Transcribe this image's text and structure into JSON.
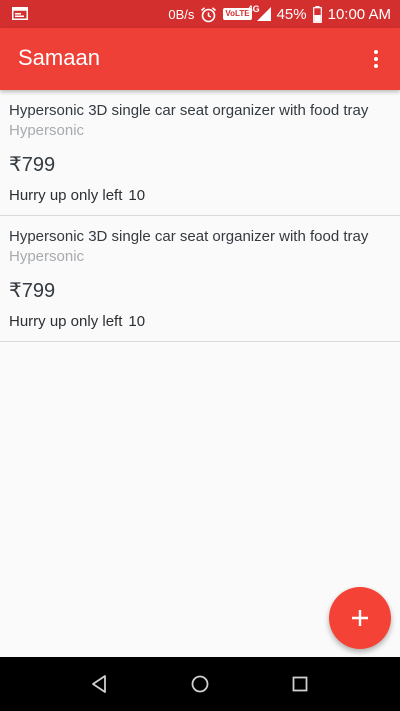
{
  "status_bar": {
    "left_icon": "notification-card-icon",
    "speed": "0B/s",
    "alarm_icon": "alarm-clock-icon",
    "volte": "VoLTE",
    "network": "4G",
    "signal_icon": "signal-icon",
    "battery_percent": "45%",
    "battery_icon": "battery-icon",
    "time": "10:00 AM"
  },
  "app_bar": {
    "title": "Samaan",
    "menu_icon": "overflow-menu-icon"
  },
  "products": [
    {
      "title": "Hypersonic 3D single car seat organizer with food tray",
      "brand": "Hypersonic",
      "price": "₹799",
      "stock_label": "Hurry up only left",
      "stock_count": "10"
    },
    {
      "title": "Hypersonic 3D single car seat organizer with food tray",
      "brand": "Hypersonic",
      "price": "₹799",
      "stock_label": "Hurry up only left",
      "stock_count": "10"
    }
  ],
  "fab": {
    "icon": "plus-icon"
  },
  "nav_bar": {
    "back_icon": "back-triangle-icon",
    "home_icon": "home-circle-icon",
    "recents_icon": "recents-square-icon"
  },
  "colors": {
    "status_bar": "#d32f2f",
    "app_bar": "#ee4036",
    "fab": "#f44336",
    "background": "#fafafa"
  }
}
